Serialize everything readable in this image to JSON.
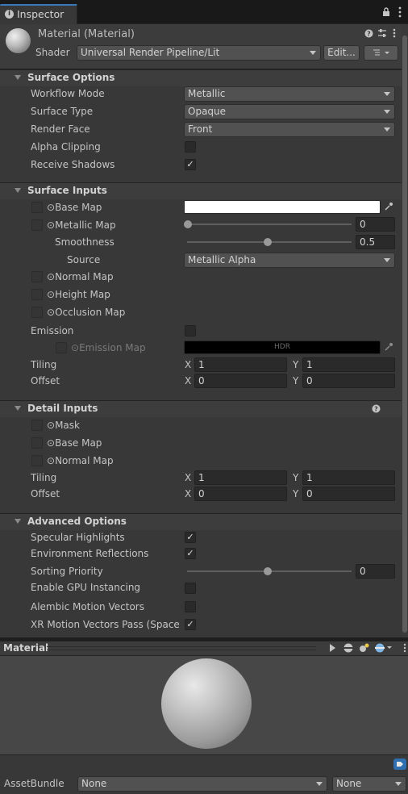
{
  "tab": {
    "label": "Inspector"
  },
  "header": {
    "title": "Material (Material)",
    "shader_label": "Shader",
    "shader_value": "Universal Render Pipeline/Lit",
    "edit_button": "Edit..."
  },
  "surface_options": {
    "title": "Surface Options",
    "workflow_mode": {
      "label": "Workflow Mode",
      "value": "Metallic"
    },
    "surface_type": {
      "label": "Surface Type",
      "value": "Opaque"
    },
    "render_face": {
      "label": "Render Face",
      "value": "Front"
    },
    "alpha_clipping": {
      "label": "Alpha Clipping",
      "checked": false
    },
    "receive_shadows": {
      "label": "Receive Shadows",
      "checked": true
    }
  },
  "surface_inputs": {
    "title": "Surface Inputs",
    "base_map": "Base Map",
    "metallic_map": {
      "label": "Metallic Map",
      "value": "0",
      "level": 0
    },
    "smoothness": {
      "label": "Smoothness",
      "value": "0.5",
      "level": 0.5
    },
    "source": {
      "label": "Source",
      "value": "Metallic Alpha"
    },
    "normal_map": "Normal Map",
    "height_map": "Height Map",
    "occlusion_map": "Occlusion Map",
    "emission": {
      "label": "Emission",
      "checked": false
    },
    "emission_map": {
      "label": "Emission Map",
      "swatch_text": "HDR"
    },
    "tiling": {
      "label": "Tiling",
      "x_label": "X",
      "x": "1",
      "y_label": "Y",
      "y": "1"
    },
    "offset": {
      "label": "Offset",
      "x_label": "X",
      "x": "0",
      "y_label": "Y",
      "y": "0"
    }
  },
  "detail_inputs": {
    "title": "Detail Inputs",
    "mask": "Mask",
    "base_map": "Base Map",
    "normal_map": "Normal Map",
    "tiling": {
      "label": "Tiling",
      "x_label": "X",
      "x": "1",
      "y_label": "Y",
      "y": "1"
    },
    "offset": {
      "label": "Offset",
      "x_label": "X",
      "x": "0",
      "y_label": "Y",
      "y": "0"
    }
  },
  "advanced_options": {
    "title": "Advanced Options",
    "specular_highlights": {
      "label": "Specular Highlights",
      "checked": true
    },
    "environment_reflections": {
      "label": "Environment Reflections",
      "checked": true
    },
    "sorting_priority": {
      "label": "Sorting Priority",
      "value": "0",
      "level": 0.5
    },
    "gpu_instancing": {
      "label": "Enable GPU Instancing",
      "checked": false
    },
    "alembic_motion_vectors": {
      "label": "Alembic Motion Vectors",
      "checked": false
    },
    "xr_motion_vectors": {
      "label": "XR Motion Vectors Pass (Space W",
      "checked": true
    }
  },
  "preview": {
    "title": "Material"
  },
  "asset_bundle": {
    "label": "AssetBundle",
    "name_value": "None",
    "variant_value": "None"
  },
  "colors": {
    "accent": "#3a79bb",
    "panel": "#383838",
    "field": "#2a2a2a",
    "base_map_color": "#ffffff",
    "emission_color": "#000000"
  },
  "icons": [
    "info-icon",
    "lock-icon",
    "kebab-menu-icon",
    "help-icon",
    "preset-icon",
    "list-icon",
    "eyedropper-icon",
    "play-icon",
    "tag-icon"
  ]
}
